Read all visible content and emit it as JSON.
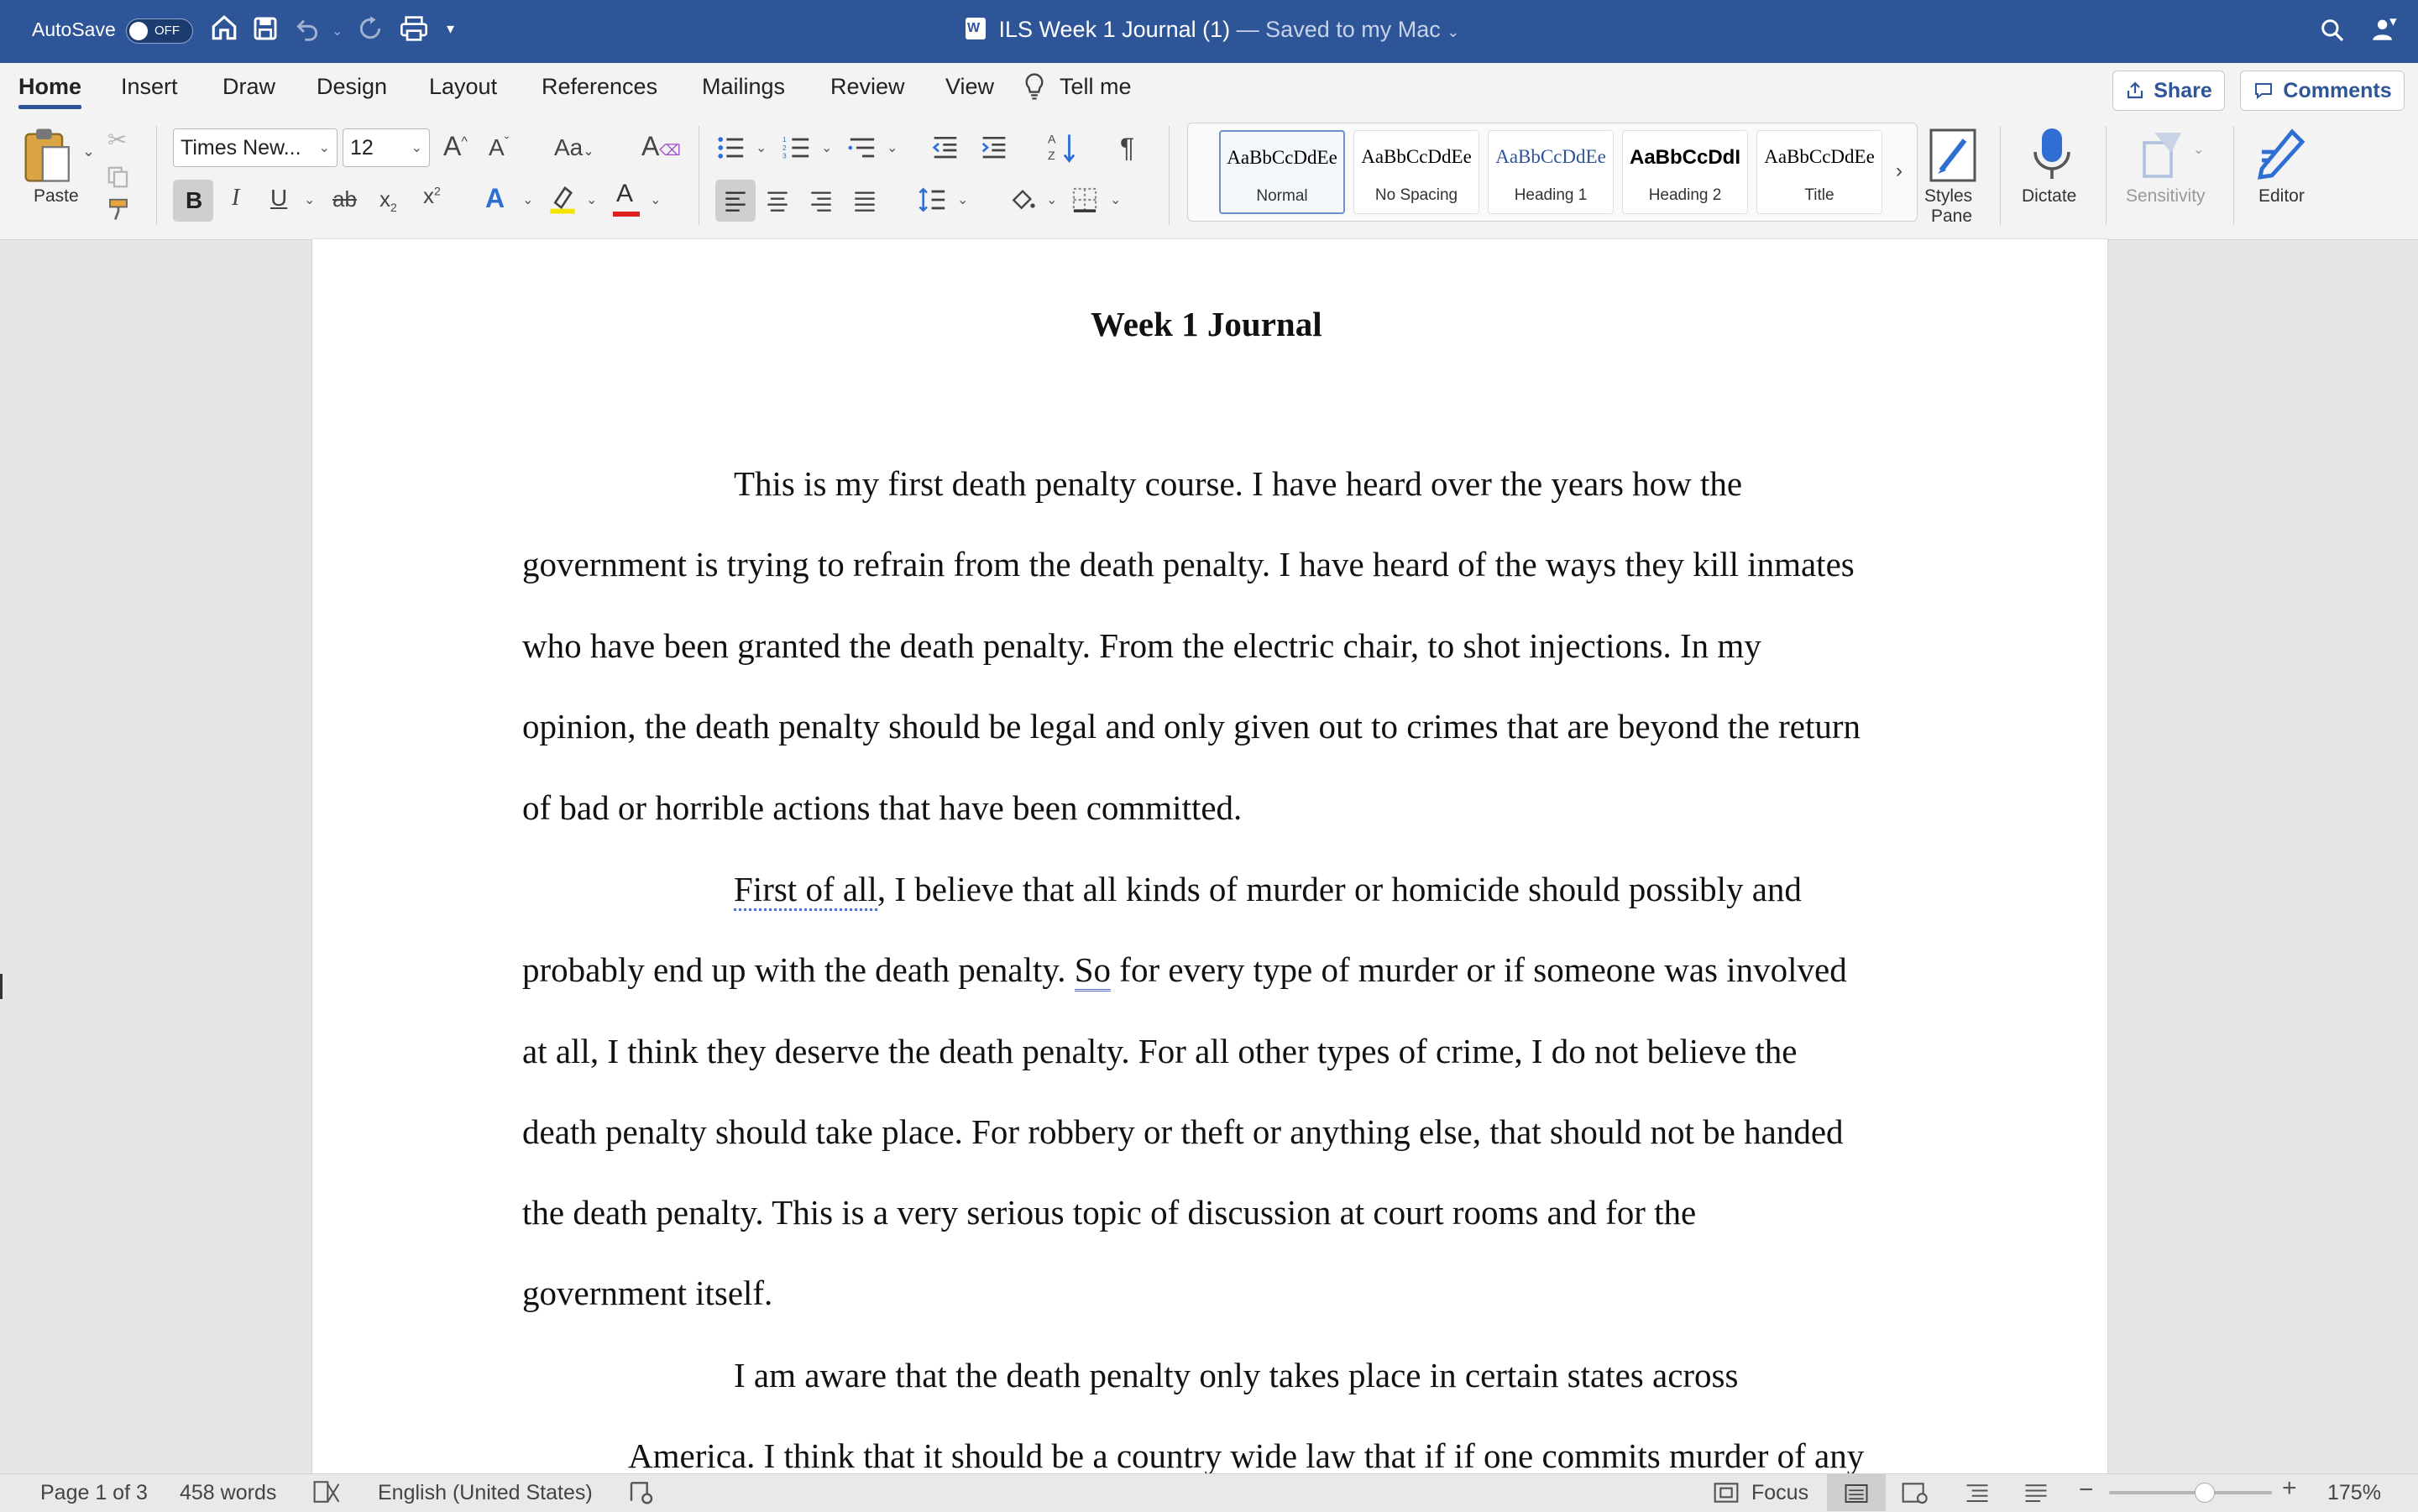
{
  "titlebar": {
    "autosave_label": "AutoSave",
    "autosave_state": "OFF",
    "doc_name": "ILS Week 1 Journal (1)",
    "saved_status": "— Saved to my Mac",
    "icons": [
      "home-icon",
      "save-icon",
      "undo-icon",
      "redo-icon",
      "print-icon",
      "customize-icon",
      "search-icon",
      "account-icon"
    ]
  },
  "tabs": [
    {
      "label": "Home",
      "active": true
    },
    {
      "label": "Insert"
    },
    {
      "label": "Draw"
    },
    {
      "label": "Design"
    },
    {
      "label": "Layout"
    },
    {
      "label": "References"
    },
    {
      "label": "Mailings"
    },
    {
      "label": "Review"
    },
    {
      "label": "View"
    }
  ],
  "tell_me": "Tell me",
  "share_label": "Share",
  "comments_label": "Comments",
  "ribbon": {
    "paste_label": "Paste",
    "font_name": "Times New...",
    "font_size": "12",
    "styles": [
      {
        "sample": "AaBbCcDdEe",
        "name": "Normal",
        "selected": true
      },
      {
        "sample": "AaBbCcDdEe",
        "name": "No Spacing"
      },
      {
        "sample": "AaBbCcDdEe",
        "name": "Heading 1"
      },
      {
        "sample": "AaBbCcDdI",
        "name": "Heading 2"
      },
      {
        "sample": "AaBbCcDdEe",
        "name": "Title"
      }
    ],
    "styles_pane_line1": "Styles",
    "styles_pane_line2": "Pane",
    "dictate_label": "Dictate",
    "sensitivity_label": "Sensitivity",
    "editor_label": "Editor",
    "accent_font_color": "#e02020",
    "accent_highlight_color": "#f5e400"
  },
  "document": {
    "heading": "Week 1 Journal",
    "lines": [
      "This is my first death penalty course. I have heard over the years how the",
      "government is trying to refrain from the death penalty. I have heard of the ways they kill inmates",
      "who have been granted the death penalty. From the electric chair, to shot injections. In my",
      "opinion, the death penalty should be legal and only given out to crimes that are beyond the return",
      "of bad or horrible actions that have been committed.",
      "First of all",
      ", I believe that all kinds of murder or homicide should possibly and",
      "probably end up with the death penalty. ",
      "So",
      " for every type of murder or if someone was involved",
      "at all, I think they deserve the death penalty. For all other types of crime, I do not believe the",
      "death penalty should take place. For robbery or theft or anything else, that should not be handed",
      "the death penalty. This is a very serious topic of discussion at court rooms and for the",
      "government itself.",
      "I am aware that the death penalty only takes place in certain states across",
      "America. I think that it should be a country wide law that if if one commits murder of any"
    ]
  },
  "statusbar": {
    "page": "Page 1 of 3",
    "words": "458 words",
    "language": "English (United States)",
    "focus": "Focus",
    "zoom": "175%"
  }
}
